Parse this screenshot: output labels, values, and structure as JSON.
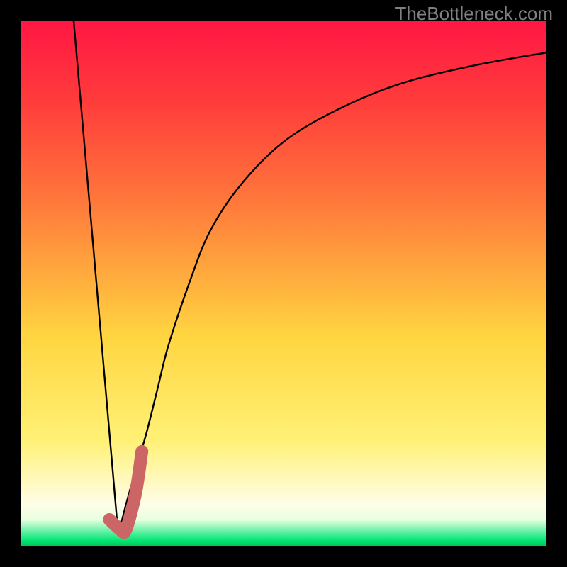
{
  "watermark": "TheBottleneck.com",
  "chart_data": {
    "type": "line",
    "title": "",
    "xlabel": "",
    "ylabel": "",
    "xlim": [
      0,
      100
    ],
    "ylim": [
      0,
      100
    ],
    "series": [
      {
        "name": "left-line",
        "x": [
          10,
          18.5
        ],
        "y": [
          100,
          2
        ]
      },
      {
        "name": "right-curve",
        "x": [
          18.5,
          20,
          22,
          24,
          26,
          28,
          32,
          36,
          42,
          50,
          60,
          72,
          86,
          100
        ],
        "y": [
          2,
          8,
          15,
          22,
          30,
          38,
          50,
          60,
          69,
          77,
          83,
          88,
          91.5,
          94
        ]
      },
      {
        "name": "hook-highlight",
        "x": [
          16.8,
          19.0,
          20.0,
          21.8,
          23.0
        ],
        "y": [
          5.0,
          3.0,
          3.2,
          10.0,
          18.0
        ]
      }
    ],
    "gradient_stops": [
      {
        "pct": 0,
        "color": "#ff1744"
      },
      {
        "pct": 15,
        "color": "#ff3b3b"
      },
      {
        "pct": 35,
        "color": "#ff7a3b"
      },
      {
        "pct": 60,
        "color": "#ffd540"
      },
      {
        "pct": 80,
        "color": "#fff176"
      },
      {
        "pct": 92,
        "color": "#fffde7"
      },
      {
        "pct": 95,
        "color": "#e8ffe0"
      },
      {
        "pct": 99,
        "color": "#00e676"
      },
      {
        "pct": 100,
        "color": "#00c853"
      }
    ],
    "colors": {
      "curve": "#000000",
      "highlight": "#cc6666",
      "frame": "#000000"
    }
  }
}
